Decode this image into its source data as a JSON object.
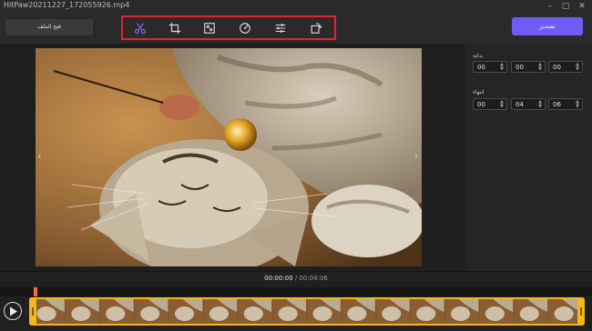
{
  "window": {
    "title": "HitPaw20211227_172055926.mp4",
    "controls": [
      "minimize-icon",
      "maximize-icon",
      "close-icon"
    ]
  },
  "toolbar": {
    "open_button": "فتح الملف",
    "export_button": "تصدير",
    "tools": [
      "scissors-icon",
      "crop-icon",
      "resize-icon",
      "speed-icon",
      "adjust-icon",
      "rotate-icon"
    ],
    "accent": "#6f5bf6",
    "highlight": "#e0242f"
  },
  "side": {
    "start_label": "بداية",
    "start_time": [
      "00",
      "00",
      "00"
    ],
    "end_label": "انتهاء",
    "end_time": [
      "00",
      "04",
      "06"
    ]
  },
  "player": {
    "current_time": "00:00:00",
    "separator": "/",
    "total_time": "00:04:06"
  },
  "timeline": {
    "frame_count": 16,
    "trim_color": "#f3b81a",
    "playhead_color": "#ff6b2e"
  }
}
